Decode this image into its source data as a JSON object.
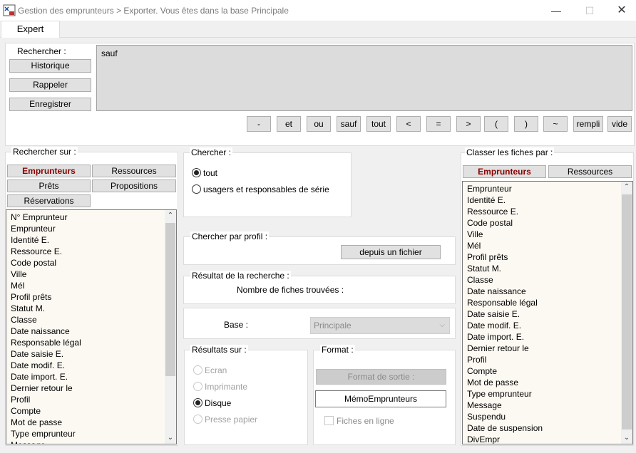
{
  "window": {
    "title": "Gestion des emprunteurs > Exporter.  Vous êtes dans la base Principale",
    "min_glyph": "—",
    "max_glyph": "☐",
    "close_glyph": "✕"
  },
  "tabs": [
    {
      "label": "Expert",
      "active": true
    }
  ],
  "search": {
    "label": "Rechercher :",
    "history_button": "Historique",
    "recall_button": "Rappeler",
    "save_button": "Enregistrer",
    "query_text": "sauf",
    "operators": [
      "-",
      "et",
      "ou",
      "sauf",
      "tout",
      "<",
      "=",
      ">",
      "(",
      ")",
      "~",
      "rempli",
      "vide"
    ]
  },
  "search_on": {
    "title": "Rechercher sur :",
    "buttons": {
      "emprunteurs": "Emprunteurs",
      "ressources": "Ressources",
      "prets": "Prêts",
      "propositions": "Propositions",
      "reservations": "Réservations"
    },
    "fields": [
      "N° Emprunteur",
      "Emprunteur",
      "Identité E.",
      "Ressource E.",
      "Code postal",
      "Ville",
      "Mél",
      "Profil prêts",
      "Statut M.",
      "Classe",
      "Date naissance",
      "Responsable légal",
      "Date saisie E.",
      "Date modif. E.",
      "Date import. E.",
      "Dernier retour le",
      "Profil",
      "Compte",
      "Mot de passe",
      "Type emprunteur",
      "Message"
    ]
  },
  "chercher": {
    "title": "Chercher :",
    "options": [
      "tout",
      "usagers et responsables de série"
    ],
    "selected": "tout"
  },
  "profile": {
    "title": "Chercher par profil :",
    "button": "depuis un fichier"
  },
  "result": {
    "title": "Résultat de la recherche :",
    "count_label": "Nombre de fiches trouvées :"
  },
  "base": {
    "label": "Base :",
    "value": "Principale",
    "chevron": "⌵"
  },
  "results_on": {
    "title": "Résultats sur :",
    "options": [
      "Ecran",
      "Imprimante",
      "Disque",
      "Presse papier"
    ],
    "selected": "Disque"
  },
  "format": {
    "title": "Format :",
    "output_button": "Format de sortie :",
    "file_value": "MémoEmprunteurs",
    "inline_label": "Fiches en ligne"
  },
  "sort": {
    "title": "Classer les fiches par :",
    "buttons": {
      "emprunteurs": "Emprunteurs",
      "ressources": "Ressources"
    },
    "fields": [
      "Emprunteur",
      "Identité E.",
      "Ressource E.",
      "Code postal",
      "Ville",
      "Mél",
      "Profil prêts",
      "Statut M.",
      "Classe",
      "Date naissance",
      "Responsable légal",
      "Date saisie E.",
      "Date modif. E.",
      "Date import. E.",
      "Dernier retour le",
      "Profil",
      "Compte",
      "Mot de passe",
      "Type emprunteur",
      "Message",
      "Suspendu",
      "Date de suspension",
      "DivEmpr"
    ]
  },
  "scroll_arrows": {
    "up": "⌃",
    "down": "⌄"
  },
  "colors": {
    "accent_red": "#8b0000",
    "panel": "#f0f0f0",
    "list_bg": "#fbf9f2"
  }
}
